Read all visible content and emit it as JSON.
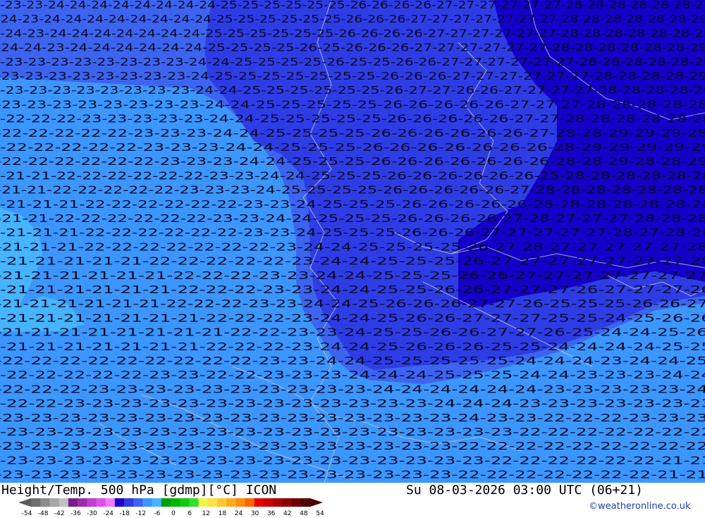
{
  "title": "Height/Temp. 500 hPa [gdmp][°C] ICON",
  "datetime": "Su 08-03-2026 03:00 UTC (06+21)",
  "credit": "©weatheronline.co.uk",
  "legend": {
    "ticks": [
      "-54",
      "-48",
      "-42",
      "-36",
      "-30",
      "-24",
      "-18",
      "-12",
      "-6",
      "0",
      "6",
      "12",
      "18",
      "24",
      "30",
      "36",
      "42",
      "48",
      "54"
    ],
    "colors": [
      "#6e6e6e",
      "#8c8c8c",
      "#a6a6a6",
      "#c0c0c0",
      "#7a1e8c",
      "#9a2db0",
      "#c03cd0",
      "#e050e8",
      "#f07cf5",
      "#1e00c8",
      "#2e3ce6",
      "#3c64f0",
      "#3c96ff",
      "#46b4ff",
      "#00a000",
      "#00b400",
      "#14c814",
      "#32dc32",
      "#f5f550",
      "#ffe146",
      "#ffc832",
      "#ffaa1e",
      "#ff8c14",
      "#ff6400",
      "#e60000",
      "#c80000",
      "#aa0000",
      "#8c0000",
      "#6e0000",
      "#500000"
    ]
  },
  "map": {
    "palette": {
      "-29": "#1400c8",
      "-28": "#1400c8",
      "-27": "#1e1ed8",
      "-26": "#2e3ce6",
      "-25": "#2e3ce6",
      "-24": "#3c64f0",
      "-23": "#3c96ff",
      "-22": "#3c96ff",
      "-21": "#46b4ff"
    },
    "rows": [
      "-23-23-24-24-24-24-24-24-24-24-25-25-25-25-25-25-26-26-26-26-27-27-27-27-27-27-28-28-28-28-28-28-28",
      "-24-23-24-24-24-24-24-24-24-24-25-25-25-25-25-25-26-26-26-27-27-27-27-27-27-27-28-28-28-28-28-28-29",
      "-24-23-24-24-24-24-24-24-24-25-25-25-25-25-25-26-26-26-26-27-27-27-27-27-27-28-28-28-28-28-28-29",
      "-24-24-23-24-24-24-24-24-24-25-25-25-25-26-25-26-26-26-27-27-27-27-27-27-28-28-28-28-28-28-29",
      "-23-23-23-23-23-23-23-23-24-24-25-25-25-25-26-25-25-26-26-27-27-27-27-27-27-28-28-28-28-28-29",
      "-23-23-23-23-23-23-23-23-24-25-25-25-25-25-25-25-26-26-26-27-27-27-27-27-27-28-28-28-28-29",
      "-23-23-23-23-23-23-23-23-24-24-25-25-25-25-25-25-26-27-27-26-26-27-27-27-27-28-28-28-28-29",
      "-23-23-23-23-23-23-23-23-24-24-25-25-25-25-25-26-26-26-26-26-27-27-27-28-28-28-28-28",
      "-22-22-22-23-23-23-23-23-24-24-25-25-25-25-25-26-26-26-26-26-27-27-28-28-28-28-28-28",
      "-22-22-22-22-22-23-23-23-24-24-25-25-25-25-26-26-26-26-26-26-27-28-28-29-29-29-28",
      "-22-22-22-22-22-23-23-23-24-24-25-25-25-26-26-26-26-26-26-26-28-29-29-29-29-29",
      "-22-22-22-22-22-22-23-23-23-24-24-25-25-25-26-26-26-26-26-26-26-28-28-29-28-28-29",
      "-21-21-22-22-22-22-22-22-23-23-24-24-25-25-25-26-26-26-26-26-26-25-28-28-28-28-28-28",
      "-21-21-22-22-22-22-22-23-23-23-24-25-25-25-25-26-26-26-26-26-27-28-28-28-28-28-28-28",
      "-21-21-21-22-22-22-22-22-22-23-23-24-25-25-25-26-26-26-26-26-28-28-28-28-28-28-28",
      "-21-21-22-22-22-22-22-22-23-23-24-24-25-25-25-26-26-26-26-27-28-27-27-27-28-28-28",
      "-21-21-21-22-22-22-22-22-22-23-23-24-25-25-25-26-26-26-27-27-27-27-27-28-27-28-28",
      "-21-21-21-22-22-22-22-22-22-22-23-24-24-25-25-25-25-26-27-28-27-27-27-27-27-28",
      "-21-21-21-21-21-22-22-22-22-22-23-24-24-25-25-25-26-27-27-27-27-27-27-27-28",
      "-21-21-21-21-21-21-22-22-22-23-23-24-24-25-25-25-26-26-27-27-27-27-27-27-27",
      "-21-21-21-21-21-21-22-22-22-23-23-24-24-25-25-26-26-27-27-27-26-27-27-27-26",
      "-21-21-21-21-21-21-22-22-22-23-23-24-24-25-26-26-26-27-27-26-25-25-25-26-26-27",
      "-21-21-21-21-21-21-21-22-22-22-23-24-24-25-26-26-27-27-27-25-25-24-25-26-26",
      "-21-21-21-21-21-21-21-21-22-22-23-23-24-25-25-26-26-27-27-26-25-24-24-25-26",
      "-21-21-21-21-21-21-21-22-22-22-23-24-24-25-26-26-26-25-25-24-24-24-24-25-25",
      "-22-22-22-22-22-22-22-22-22-23-23-24-24-25-25-25-25-25-24-24-24-23-24-24-25",
      "-22-22-22-22-22-23-23-22-22-23-23-23-24-24-24-25-25-25-24-24-23-23-23-24-24",
      "-22-22-22-23-23-23-23-23-23-23-23-23-23-24-24-24-24-24-24-23-23-23-23-23-24",
      "-22-22-23-23-23-23-23-23-23-23-23-23-23-23-23-24-24-24-23-23-23-23-23-23-23",
      "-23-23-23-23-23-23-23-23-23-23-23-23-23-23-23-23-24-23-23-22-22-22-23-23-23",
      "-23-23-23-23-23-23-23-23-23-23-23-23-23-23-23-23-23-23-22-22-22-22-22-22-22",
      "-23-23-23-23-23-23-23-23-23-23-23-23-23-23-23-23-22-22-22-22-22-22-22-22-22",
      "-23-23-23-23-23-23-23-23-23-23-23-23-23-23-23-23-23-22-22-22-22-22-22-21-21",
      "-23-23-23-23-23-23-23-23-23-23-23-23-23-23-23-23-22-22-22-22-22-22-22-21-21"
    ]
  }
}
